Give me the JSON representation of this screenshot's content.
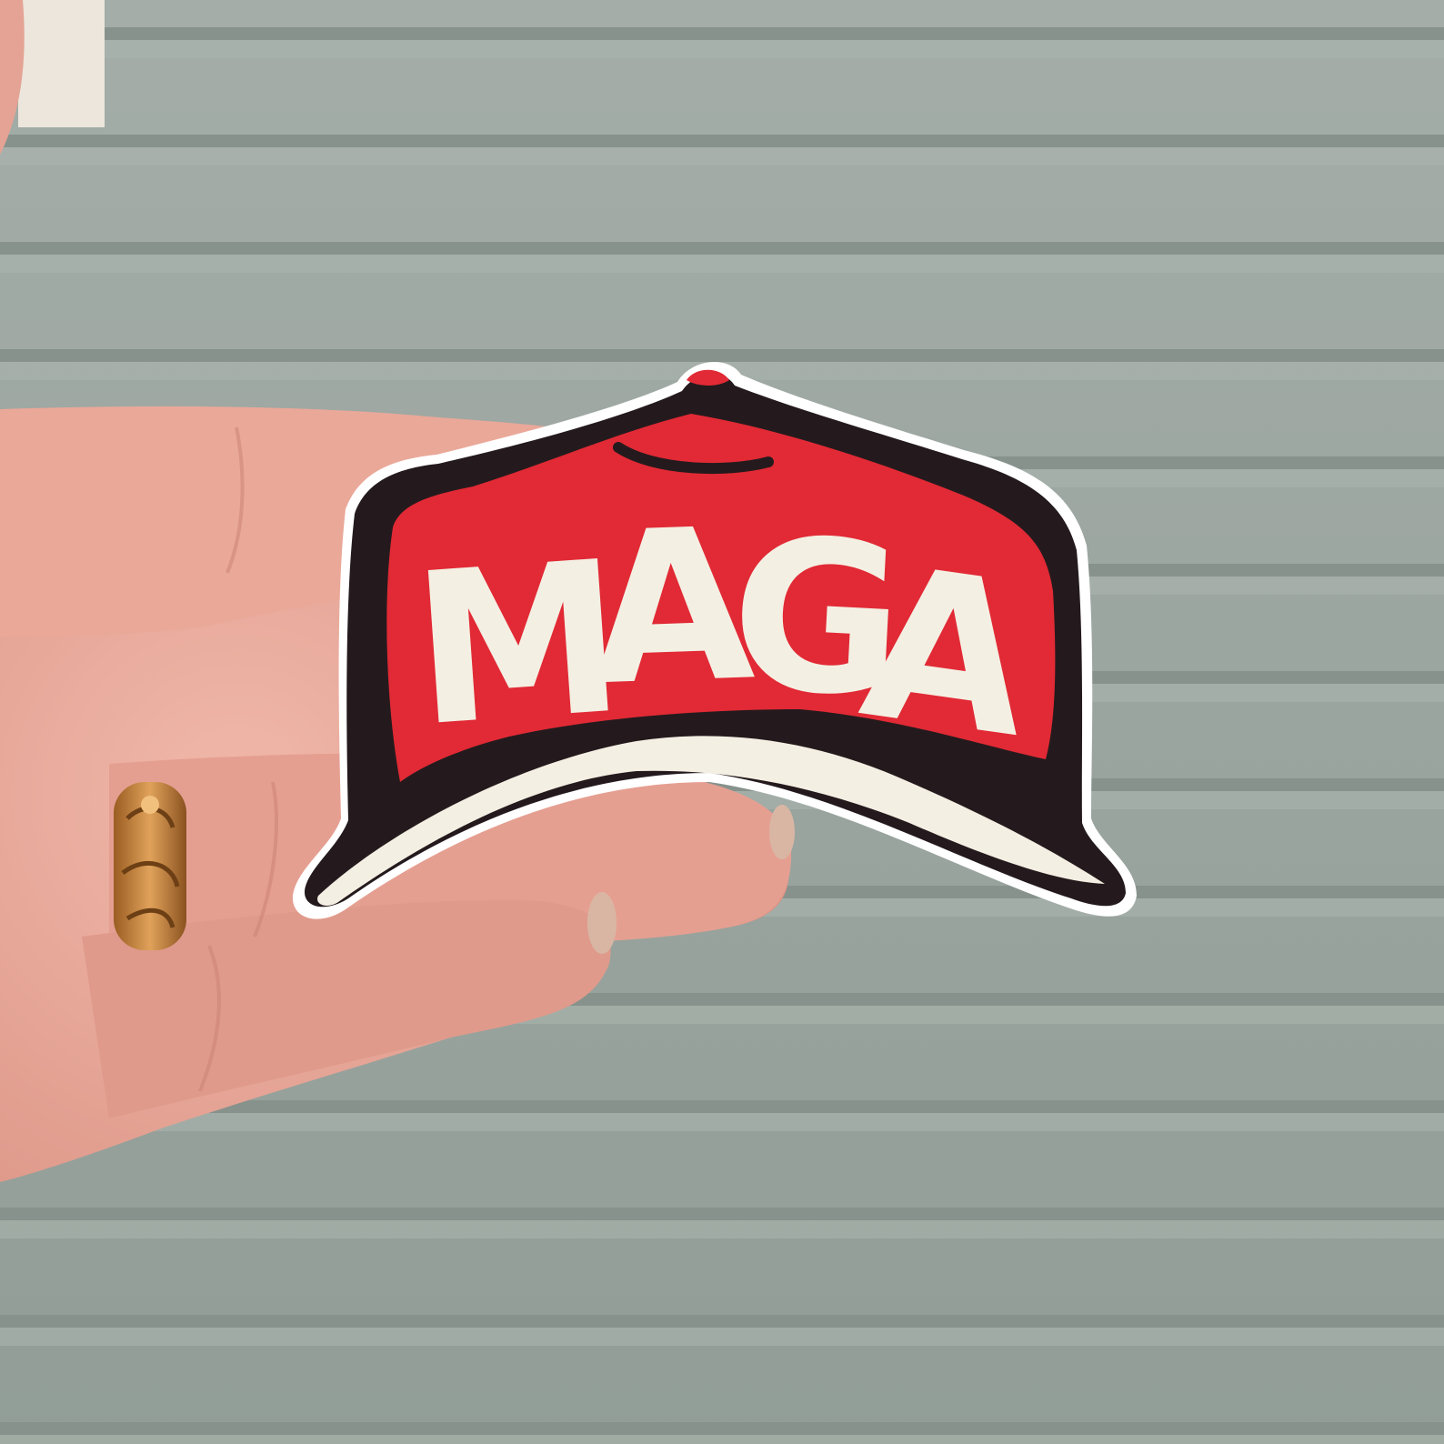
{
  "scene": {
    "description_free": true,
    "colors": {
      "siding": "#9aa59f",
      "siding_shadow": "#87928c",
      "siding_highlight": "#aab4ae",
      "skin": "#e9a89a",
      "skin_shadow": "#c98074",
      "sticker_red": "#e12a35",
      "sticker_black": "#241a1d",
      "sticker_cream": "#f4efe3",
      "sticker_border": "#ffffff",
      "ring_gold": "#c8873e"
    }
  },
  "sticker": {
    "text": "MAGA",
    "letters": [
      "M",
      "A",
      "G",
      "A"
    ]
  }
}
